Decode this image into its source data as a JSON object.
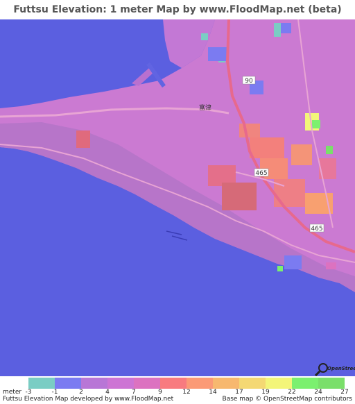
{
  "title": "Futtsu Elevation: 1 meter Map by www.FloodMap.net (beta)",
  "map": {
    "road_labels": [
      "90",
      "465",
      "465"
    ],
    "place_label": "富津",
    "osm_badge_text": "OpenStreetMap"
  },
  "legend": {
    "unit_label": "meter",
    "ticks": [
      "-3",
      "-1",
      "2",
      "4",
      "7",
      "9",
      "12",
      "14",
      "17",
      "19",
      "22",
      "24",
      "27"
    ],
    "colors": [
      "#7acdc4",
      "#7b7bf1",
      "#b876d6",
      "#cd74d4",
      "#dc72c0",
      "#f87b7f",
      "#fb9a76",
      "#f7b86f",
      "#f4d873",
      "#f3f579",
      "#7bf06f",
      "#7adf6a"
    ]
  },
  "footer": {
    "left": "Futtsu Elevation Map developed by www.FloodMap.net",
    "right": "Base map © OpenStreetMap contributors"
  }
}
